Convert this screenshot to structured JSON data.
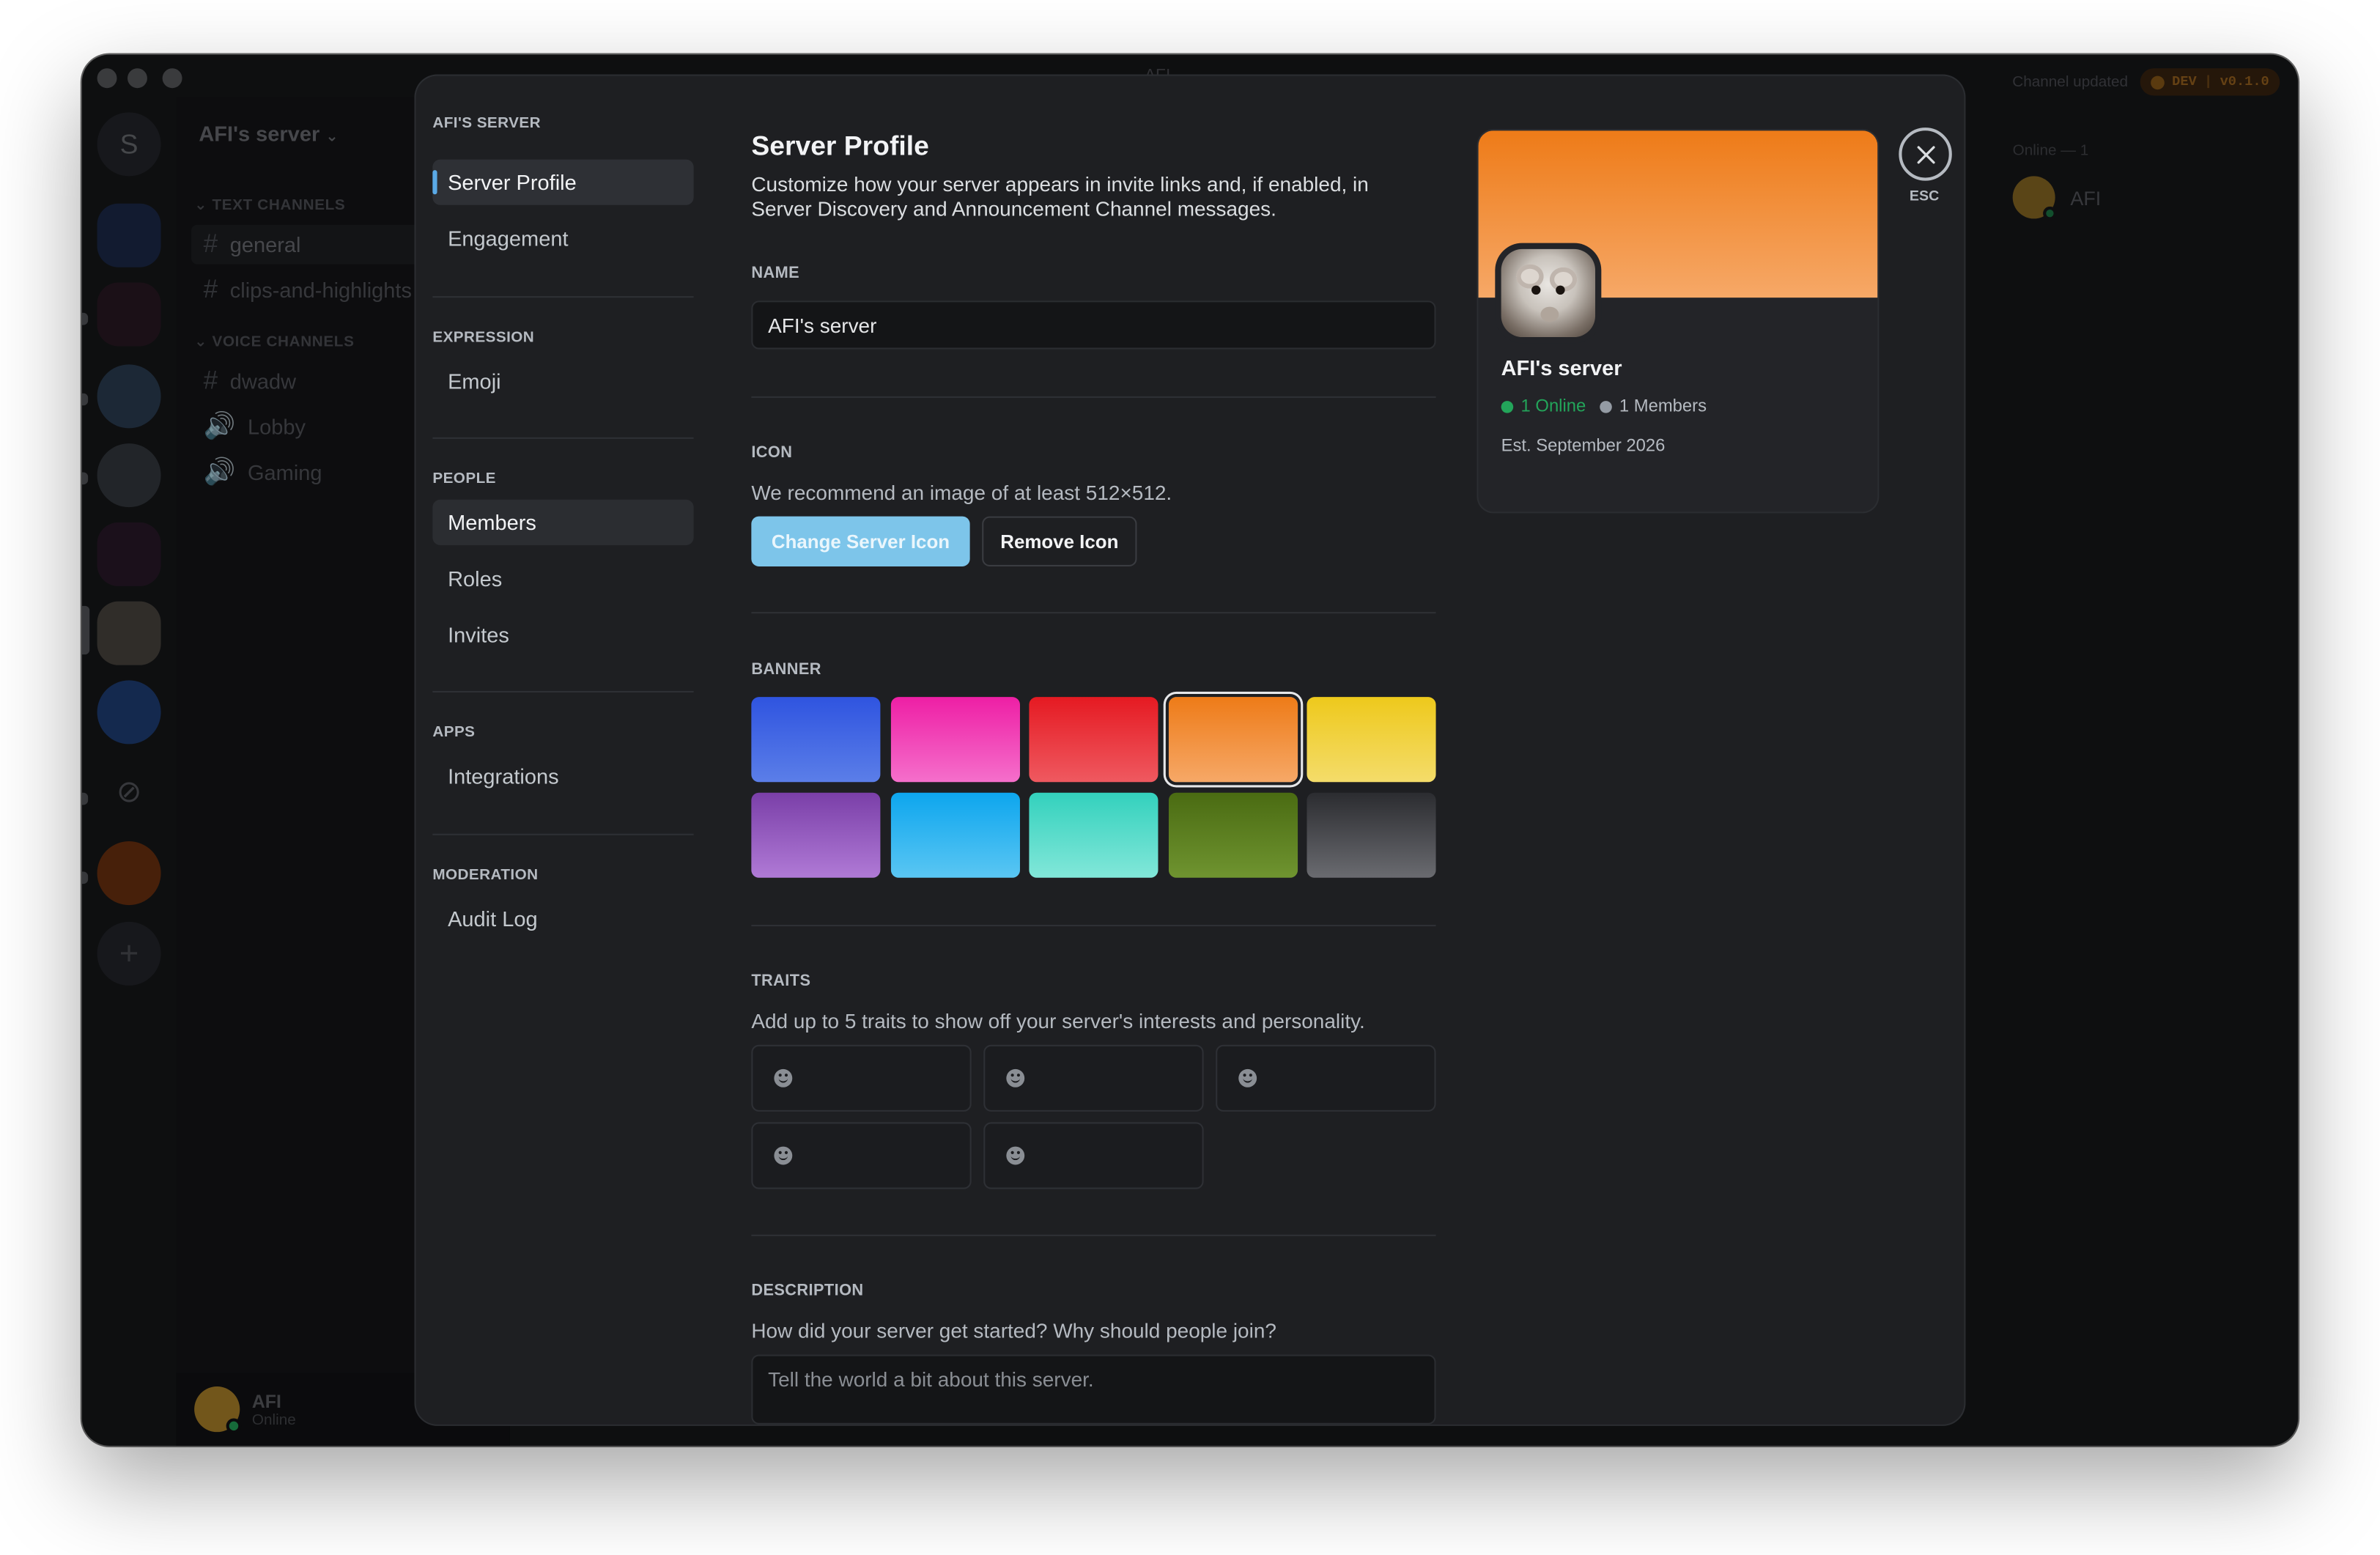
{
  "window": {
    "title": "AFI",
    "channel_updated": "Channel updated",
    "dev_badge": "DEV",
    "version": "v0.1.0"
  },
  "guild_rail": {
    "home_letter": "S"
  },
  "server": {
    "name": "AFI's server",
    "text_channels_header": "TEXT CHANNELS",
    "voice_channels_header": "VOICE CHANNELS",
    "text_channels": [
      "general",
      "clips-and-highlights"
    ],
    "voice_channels": [
      "dwadw",
      "Lobby",
      "Gaming"
    ]
  },
  "user": {
    "name": "AFI",
    "status": "Online"
  },
  "member_list": {
    "header": "Online — 1",
    "members": [
      "AFI"
    ]
  },
  "settings_nav": {
    "server_header": "AFI'S SERVER",
    "server_profile": "Server Profile",
    "engagement": "Engagement",
    "expression_header": "EXPRESSION",
    "emoji": "Emoji",
    "people_header": "PEOPLE",
    "members": "Members",
    "roles": "Roles",
    "invites": "Invites",
    "apps_header": "APPS",
    "integrations": "Integrations",
    "moderation_header": "MODERATION",
    "audit_log": "Audit Log"
  },
  "profile": {
    "title": "Server Profile",
    "subtitle": "Customize how your server appears in invite links and, if enabled, in Server Discovery and Announcement Channel messages.",
    "name_label": "NAME",
    "name_value": "AFI's server",
    "icon_label": "ICON",
    "icon_hint": "We recommend an image of at least 512×512.",
    "change_icon_button": "Change Server Icon",
    "remove_icon_button": "Remove Icon",
    "banner_label": "BANNER",
    "banner_colors": [
      {
        "name": "blue",
        "from": "#2f54e0",
        "to": "#5b7ee8"
      },
      {
        "name": "pink",
        "from": "#ee1fa5",
        "to": "#f56fcb"
      },
      {
        "name": "red",
        "from": "#e51a22",
        "to": "#ef5960"
      },
      {
        "name": "orange",
        "from": "#ee7b18",
        "to": "#f6a867",
        "selected": true
      },
      {
        "name": "yellow",
        "from": "#eec91c",
        "to": "#f4dc6a"
      },
      {
        "name": "purple",
        "from": "#7a3fa8",
        "to": "#b07ad6"
      },
      {
        "name": "sky",
        "from": "#0da6ee",
        "to": "#5ac6f3"
      },
      {
        "name": "teal",
        "from": "#33d1bd",
        "to": "#82e7d9"
      },
      {
        "name": "olive",
        "from": "#4a6b12",
        "to": "#6f9430"
      },
      {
        "name": "gray",
        "from": "#2b2c30",
        "to": "#6a6b70"
      }
    ],
    "traits_label": "TRAITS",
    "traits_hint": "Add up to 5 traits to show off your server's interests and personality.",
    "trait_slots": 5,
    "description_label": "DESCRIPTION",
    "description_hint": "How did your server get started? Why should people join?",
    "description_placeholder": "Tell the world a bit about this server."
  },
  "preview": {
    "name": "AFI's server",
    "online": "1 Online",
    "members": "1 Members",
    "established": "Est. September 2026"
  },
  "close": {
    "esc_label": "ESC"
  }
}
